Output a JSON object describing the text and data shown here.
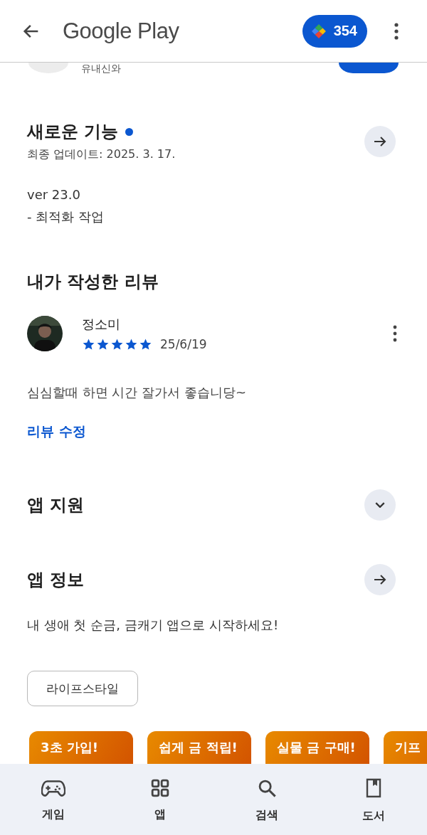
{
  "header": {
    "title": "Google Play",
    "points": "354"
  },
  "app_row": {
    "subtitle": "유내신와"
  },
  "whats_new": {
    "title": "새로운 기능",
    "unread": true,
    "last_updated": "최종 업데이트: 2025. 3. 17.",
    "notes": [
      "ver 23.0",
      "- 최적화 작업"
    ]
  },
  "my_review": {
    "title": "내가 작성한 리뷰",
    "author": "정소미",
    "stars": 5,
    "date": "25/6/19",
    "text": "심심할때 하면 시간 잘가서 좋습니당~",
    "edit_link": "리뷰 수정"
  },
  "app_support": {
    "title": "앱 지원",
    "expanded": false
  },
  "app_info": {
    "title": "앱 정보",
    "description": "내 생애 첫 순금, 금캐기 앱으로 시작하세요!"
  },
  "tags": [
    {
      "label": "라이프스타일"
    }
  ],
  "screenshots": [
    {
      "headline": "3초 가입!"
    },
    {
      "headline": "쉽게 금 적립!"
    },
    {
      "headline": "실물 금 구매!"
    },
    {
      "headline": "기프"
    }
  ],
  "nav": [
    {
      "label": "게임",
      "selected": false
    },
    {
      "label": "앱",
      "selected": false
    },
    {
      "label": "검색",
      "selected": false
    },
    {
      "label": "도서",
      "selected": false
    }
  ]
}
